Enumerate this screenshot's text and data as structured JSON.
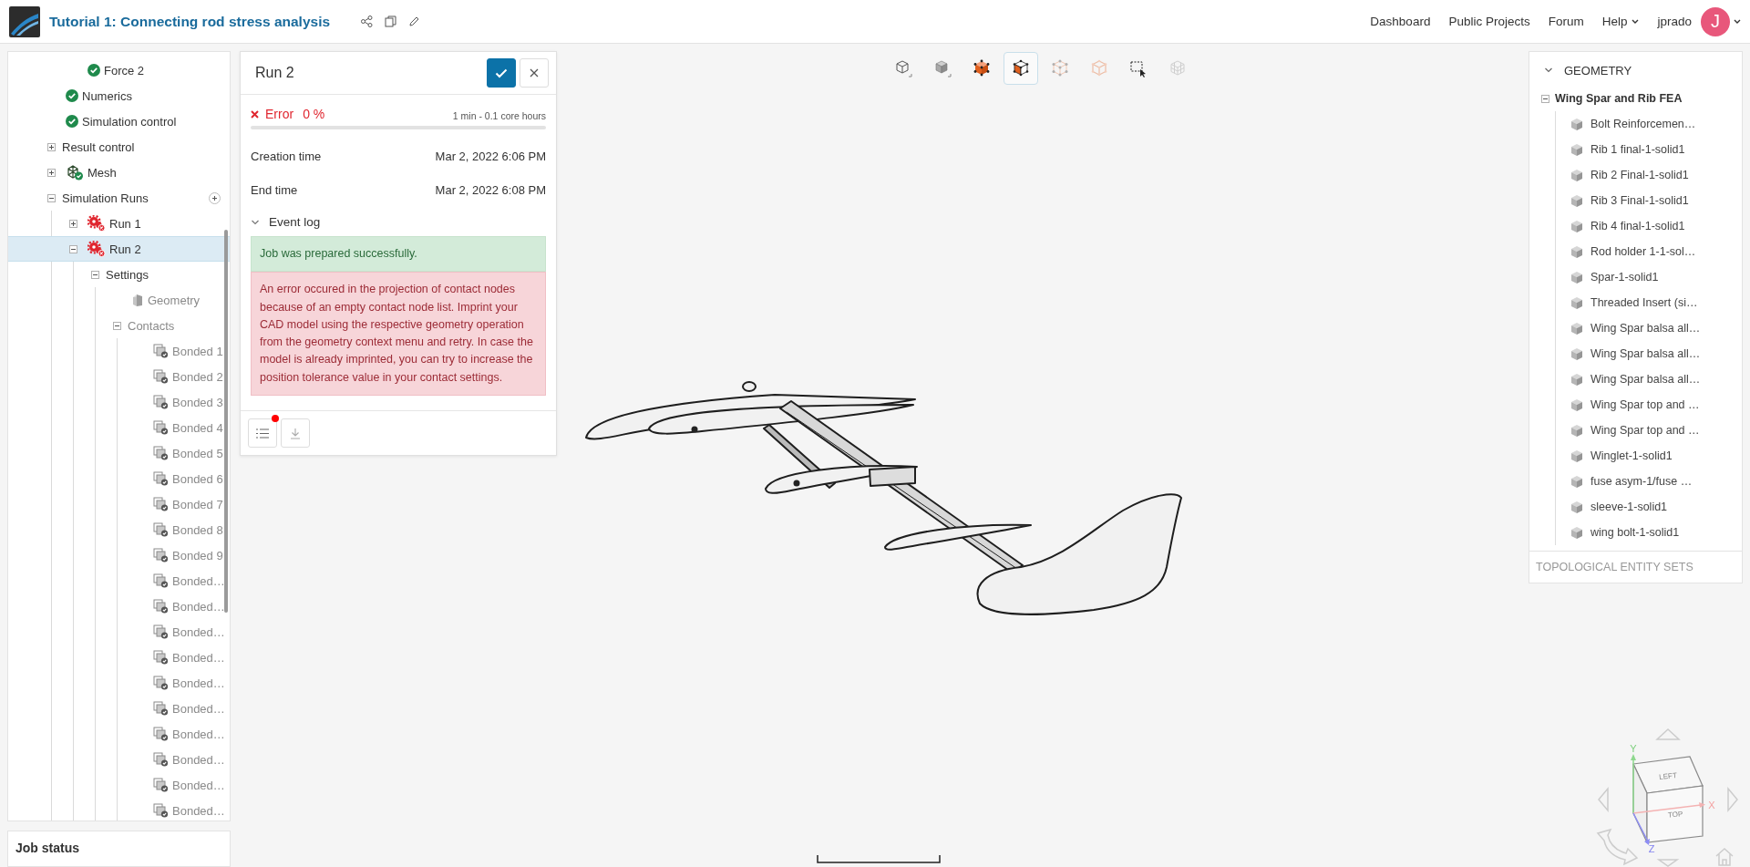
{
  "header": {
    "title": "Tutorial 1: Connecting rod stress analysis",
    "nav": [
      {
        "label": "Dashboard",
        "kind": "link"
      },
      {
        "label": "Public Projects",
        "kind": "link"
      },
      {
        "label": "Forum",
        "kind": "link"
      },
      {
        "label": "Help",
        "kind": "menu"
      },
      {
        "label": "jprado",
        "kind": "user"
      }
    ],
    "avatar": {
      "initial": "J"
    }
  },
  "tree": {
    "continued": [
      {
        "label": "Force 2",
        "kind": "check",
        "selected": false,
        "disabled": false
      }
    ],
    "items": [
      {
        "label": "Numerics",
        "kind": "check",
        "selected": false,
        "disabled": false
      },
      {
        "label": "Simulation control",
        "kind": "check",
        "selected": false,
        "disabled": false
      },
      {
        "label": "Result control",
        "expanded": false,
        "selected": false,
        "disabled": false
      },
      {
        "label": "Mesh",
        "kind": "mesh",
        "expanded": false,
        "selected": false,
        "disabled": false
      },
      {
        "label": "Simulation Runs",
        "expanded": true,
        "addable": true,
        "selected": false,
        "disabled": false,
        "children": [
          {
            "label": "Run 1",
            "kind": "run-error",
            "expanded": false,
            "selected": false,
            "disabled": false
          },
          {
            "label": "Run 2",
            "kind": "run-error",
            "expanded": true,
            "selected": true,
            "disabled": false,
            "children": [
              {
                "label": "Settings",
                "expanded": true,
                "selected": false,
                "disabled": false,
                "children": [
                  {
                    "label": "Geometry",
                    "kind": "geometry",
                    "selected": false,
                    "disabled": true
                  },
                  {
                    "label": "Contacts",
                    "expanded": true,
                    "selected": false,
                    "disabled": true,
                    "children": [
                      {
                        "label": "Bonded 1",
                        "kind": "contact",
                        "selected": false,
                        "disabled": true
                      },
                      {
                        "label": "Bonded 2",
                        "kind": "contact",
                        "selected": false,
                        "disabled": true
                      },
                      {
                        "label": "Bonded 3",
                        "kind": "contact",
                        "selected": false,
                        "disabled": true
                      },
                      {
                        "label": "Bonded 4",
                        "kind": "contact",
                        "selected": false,
                        "disabled": true
                      },
                      {
                        "label": "Bonded 5",
                        "kind": "contact",
                        "selected": false,
                        "disabled": true
                      },
                      {
                        "label": "Bonded 6",
                        "kind": "contact",
                        "selected": false,
                        "disabled": true
                      },
                      {
                        "label": "Bonded 7",
                        "kind": "contact",
                        "selected": false,
                        "disabled": true
                      },
                      {
                        "label": "Bonded 8",
                        "kind": "contact",
                        "selected": false,
                        "disabled": true
                      },
                      {
                        "label": "Bonded 9",
                        "kind": "contact",
                        "selected": false,
                        "disabled": true
                      },
                      {
                        "label": "Bonded…",
                        "kind": "contact",
                        "selected": false,
                        "disabled": true
                      },
                      {
                        "label": "Bonded…",
                        "kind": "contact",
                        "selected": false,
                        "disabled": true
                      },
                      {
                        "label": "Bonded…",
                        "kind": "contact",
                        "selected": false,
                        "disabled": true
                      },
                      {
                        "label": "Bonded…",
                        "kind": "contact",
                        "selected": false,
                        "disabled": true
                      },
                      {
                        "label": "Bonded…",
                        "kind": "contact",
                        "selected": false,
                        "disabled": true
                      },
                      {
                        "label": "Bonded…",
                        "kind": "contact",
                        "selected": false,
                        "disabled": true
                      },
                      {
                        "label": "Bonded…",
                        "kind": "contact",
                        "selected": false,
                        "disabled": true
                      },
                      {
                        "label": "Bonded…",
                        "kind": "contact",
                        "selected": false,
                        "disabled": true
                      },
                      {
                        "label": "Bonded…",
                        "kind": "contact",
                        "selected": false,
                        "disabled": true
                      },
                      {
                        "label": "Bonded…",
                        "kind": "contact",
                        "selected": false,
                        "disabled": true
                      }
                    ]
                  }
                ]
              }
            ]
          }
        ]
      }
    ]
  },
  "job_status": {
    "title": "Job status"
  },
  "run": {
    "title": "Run 2",
    "status": {
      "kind": "error",
      "label": "Error",
      "percent": "0 %",
      "level": 0,
      "duration": "1 min - 0.1 core hours"
    },
    "fields": [
      {
        "label": "Creation time",
        "value": "Mar 2, 2022 6:06 PM"
      },
      {
        "label": "End time",
        "value": "Mar 2, 2022 6:08 PM"
      }
    ],
    "event_log": {
      "title": "Event log",
      "expanded": true,
      "messages": [
        {
          "kind": "success",
          "text": "Job was prepared successfully."
        },
        {
          "kind": "error",
          "text": "An error occured in the projection of contact nodes because of an empty contact node list. Imprint your CAD model using the respective geometry operation from the geometry context menu and retry. In case the model is already imprinted, you can try to increase the position tolerance value in your contact settings."
        }
      ]
    },
    "log_unread": true
  },
  "toolbar": [
    {
      "kind": "wireframe",
      "selected": false,
      "disabled": false
    },
    {
      "kind": "solid",
      "selected": false,
      "disabled": false
    },
    {
      "kind": "vertices",
      "selected": false,
      "disabled": false
    },
    {
      "kind": "faces",
      "selected": true,
      "disabled": false
    },
    {
      "kind": "points",
      "selected": false,
      "disabled": true
    },
    {
      "kind": "edges",
      "selected": false,
      "disabled": true
    },
    {
      "kind": "select",
      "selected": false,
      "disabled": false
    },
    {
      "kind": "mesh",
      "selected": false,
      "disabled": true
    }
  ],
  "geometry": {
    "title": "GEOMETRY",
    "expanded": true,
    "root": {
      "label": "Wing Spar and Rib FEA",
      "expanded": true,
      "children": [
        {
          "label": "Bolt Reinforcemen…"
        },
        {
          "label": "Rib 1 final-1-solid1"
        },
        {
          "label": "Rib 2 Final-1-solid1"
        },
        {
          "label": "Rib 3 Final-1-solid1"
        },
        {
          "label": "Rib 4 final-1-solid1"
        },
        {
          "label": "Rod holder 1-1-sol…"
        },
        {
          "label": "Spar-1-solid1"
        },
        {
          "label": "Threaded Insert (si…"
        },
        {
          "label": "Wing Spar balsa all…"
        },
        {
          "label": "Wing Spar balsa all…"
        },
        {
          "label": "Wing Spar balsa all…"
        },
        {
          "label": "Wing Spar top and …"
        },
        {
          "label": "Wing Spar top and …"
        },
        {
          "label": "Winglet-1-solid1"
        },
        {
          "label": "fuse asym-1/fuse …"
        },
        {
          "label": "sleeve-1-solid1"
        },
        {
          "label": "wing bolt-1-solid1"
        }
      ]
    },
    "topological_sets": {
      "title": "TOPOLOGICAL ENTITY SETS"
    }
  },
  "view_cube": {
    "faces": [
      "LEFT",
      "TOP"
    ],
    "axes": [
      "X",
      "Y",
      "Z"
    ]
  }
}
